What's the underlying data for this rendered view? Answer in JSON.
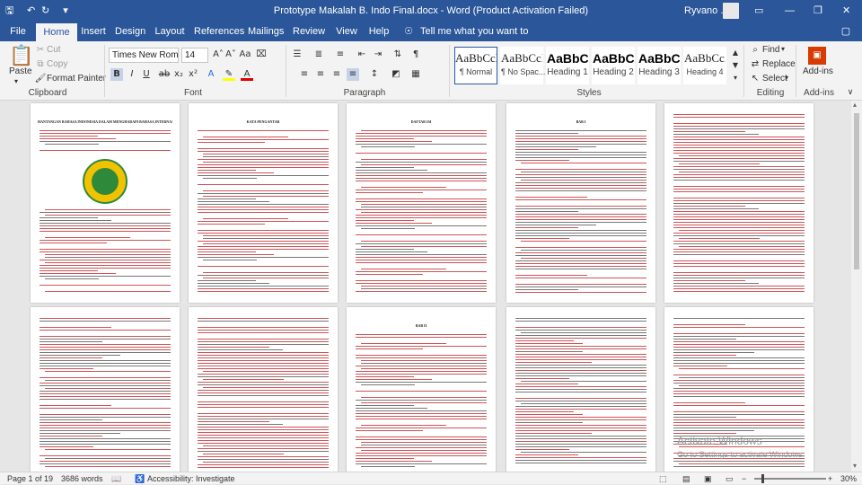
{
  "titlebar": {
    "title": "Prototype Makalah B. Indo Final.docx - Word (Product Activation Failed)",
    "user": "Ryvano ...",
    "save_icon": "save-icon",
    "undo_icon": "undo-icon",
    "redo_icon": "redo-icon"
  },
  "tabs": [
    "File",
    "Home",
    "Insert",
    "Design",
    "Layout",
    "References",
    "Mailings",
    "Review",
    "View",
    "Help"
  ],
  "tell_me": "Tell me what you want to do",
  "ribbon": {
    "clipboard": {
      "label": "Clipboard",
      "paste": "Paste",
      "cut": "Cut",
      "copy": "Copy",
      "format_painter": "Format Painter"
    },
    "font": {
      "label": "Font",
      "family": "Times New Roma",
      "size": "14"
    },
    "paragraph": {
      "label": "Paragraph"
    },
    "styles": {
      "label": "Styles",
      "items": [
        {
          "preview": "AaBbCcDc",
          "name": "¶ Normal"
        },
        {
          "preview": "AaBbCcDc",
          "name": "¶ No Spac..."
        },
        {
          "preview": "AaBbC",
          "name": "Heading 1"
        },
        {
          "preview": "AaBbC",
          "name": "Heading 2"
        },
        {
          "preview": "AaBbC",
          "name": "Heading 3"
        },
        {
          "preview": "AaBbCc.",
          "name": "Heading 4"
        }
      ]
    },
    "editing": {
      "label": "Editing",
      "find": "Find",
      "replace": "Replace",
      "select": "Select"
    },
    "addins": {
      "label": "Add-ins",
      "button": "Add-ins"
    }
  },
  "pages": [
    {
      "title": "HANTANGAN BAHASA INDONESIA DALAM MENGHADAPI BAHASA INTERNASIONAL"
    },
    {
      "title": "KATA PENGANTAR"
    },
    {
      "title": "DAFTAR ISI"
    },
    {
      "title": "BAB I"
    },
    {
      "title": ""
    },
    {
      "title": ""
    },
    {
      "title": ""
    },
    {
      "title": "BAB II"
    },
    {
      "title": ""
    },
    {
      "title": ""
    }
  ],
  "status": {
    "page": "Page 1 of 19",
    "words": "3686 words",
    "accessibility": "Accessibility: Investigate",
    "zoom": "30%"
  },
  "watermark": {
    "line1": "Activate Windows",
    "line2": "Go to Settings to activate Windows."
  }
}
